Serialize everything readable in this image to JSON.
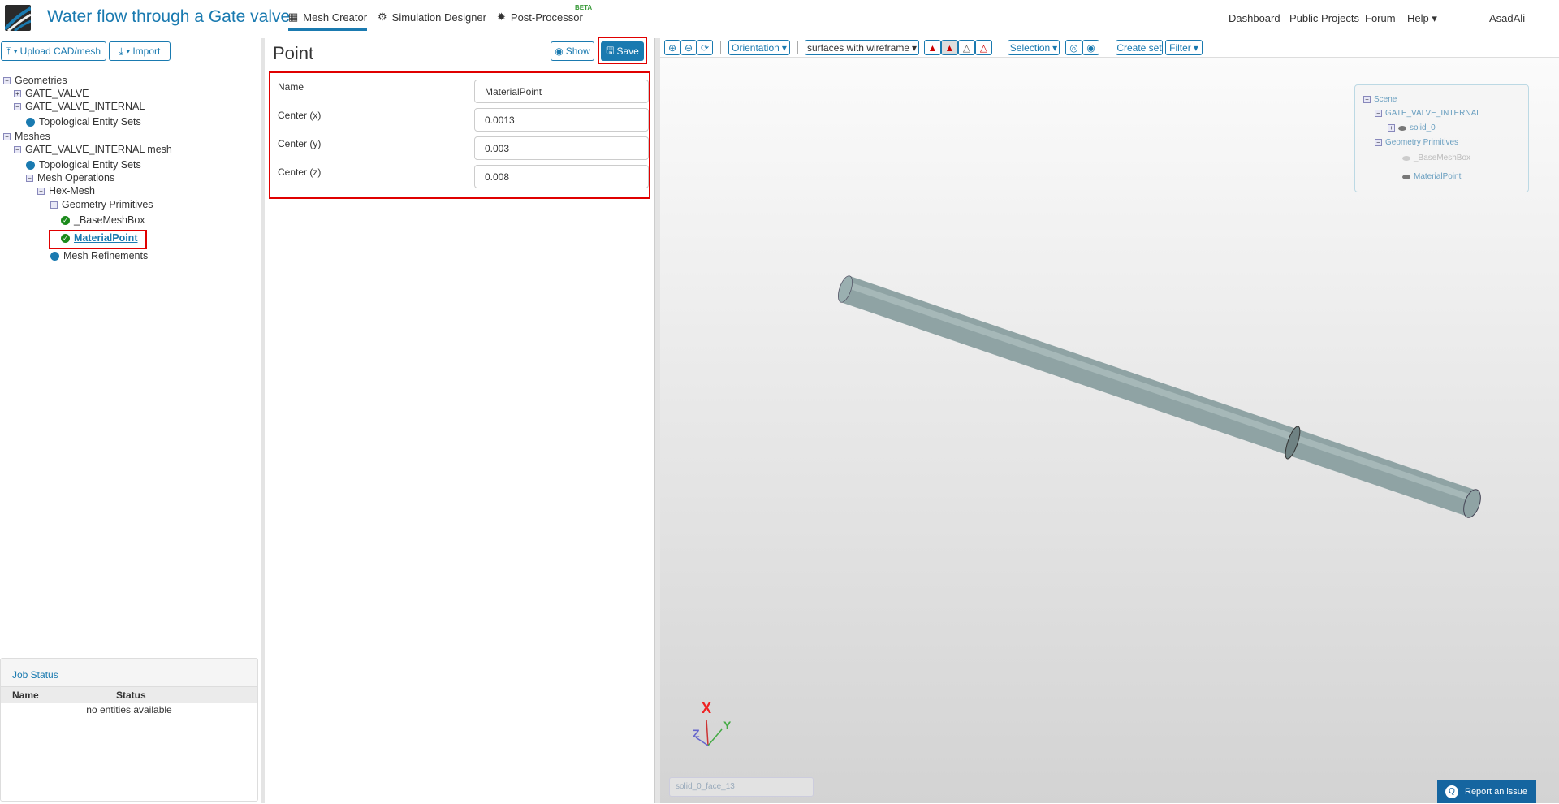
{
  "header": {
    "title": "Water flow through a Gate valve",
    "tabs": [
      {
        "label": "Mesh Creator",
        "icon": "grid-icon"
      },
      {
        "label": "Simulation Designer",
        "icon": "gears-icon"
      },
      {
        "label": "Post-Processor",
        "icon": "cog-icon",
        "badge": "BETA"
      }
    ],
    "nav": [
      "Dashboard",
      "Public Projects",
      "Forum",
      "Help",
      "AsadAli"
    ]
  },
  "left": {
    "upload_label": "Upload CAD/mesh",
    "import_label": "Import",
    "tree": [
      {
        "label": "Geometries",
        "type": "minus"
      },
      {
        "label": "GATE_VALVE",
        "type": "plus"
      },
      {
        "label": "GATE_VALVE_INTERNAL",
        "type": "minus"
      },
      {
        "label": "Topological Entity Sets",
        "type": "dot"
      },
      {
        "label": "Meshes",
        "type": "minus"
      },
      {
        "label": "GATE_VALVE_INTERNAL mesh",
        "type": "minus"
      },
      {
        "label": "Topological Entity Sets",
        "type": "dot"
      },
      {
        "label": "Mesh Operations",
        "type": "minus"
      },
      {
        "label": "Hex-Mesh",
        "type": "minus"
      },
      {
        "label": "Geometry Primitives",
        "type": "minus"
      },
      {
        "label": "_BaseMeshBox",
        "type": "check"
      },
      {
        "label": "MaterialPoint",
        "type": "check"
      },
      {
        "label": "Mesh Refinements",
        "type": "dot"
      }
    ],
    "job_status": {
      "title": "Job Status",
      "columns": [
        "Name",
        "Status"
      ],
      "empty": "no entities available"
    }
  },
  "form": {
    "title": "Point",
    "show_label": "Show",
    "save_label": "Save",
    "fields": [
      {
        "label": "Name",
        "value": "MaterialPoint"
      },
      {
        "label": "Center (x)",
        "value": "0.0013"
      },
      {
        "label": "Center (y)",
        "value": "0.003"
      },
      {
        "label": "Center (z)",
        "value": "0.008"
      }
    ]
  },
  "viewer": {
    "orientation_label": "Orientation",
    "render_mode": "surfaces with wireframe",
    "selection_label": "Selection",
    "create_set_label": "Create set",
    "filter_label": "Filter",
    "scene": {
      "root": "Scene",
      "geometry": "GATE_VALVE_INTERNAL",
      "solid": "solid_0",
      "primitives": "Geometry Primitives",
      "base": "_BaseMeshBox",
      "point": "MaterialPoint"
    },
    "axes": {
      "x": "X",
      "y": "Y",
      "z": "Z"
    },
    "selection_text": "solid_0_face_13",
    "report_label": "Report an issue"
  },
  "colors": {
    "accent": "#1a7ab0",
    "highlight": "#e00000"
  }
}
